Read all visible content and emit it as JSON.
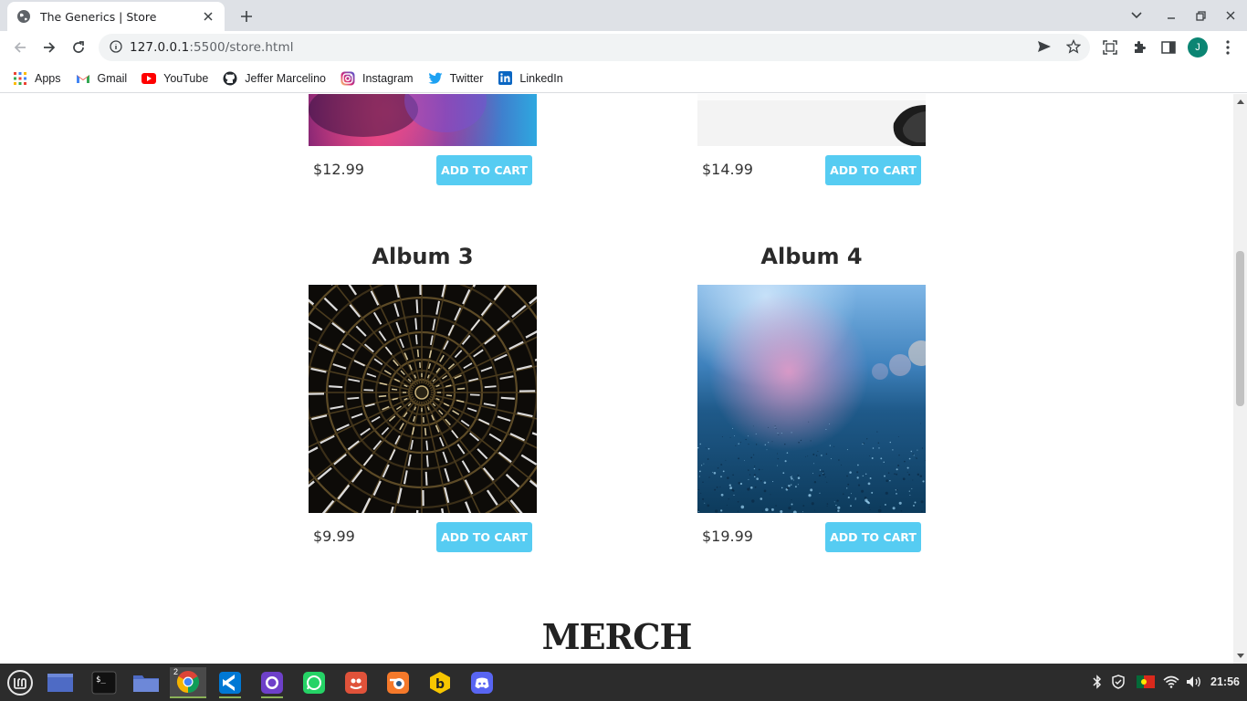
{
  "browser": {
    "tab_title": "The Generics | Store",
    "url_host": "127.0.0.1",
    "url_path": ":5500/store.html",
    "profile_initial": "J"
  },
  "bookmarks": [
    {
      "label": "Apps",
      "icon": "apps-grid-icon"
    },
    {
      "label": "Gmail",
      "icon": "gmail-icon"
    },
    {
      "label": "YouTube",
      "icon": "youtube-icon"
    },
    {
      "label": "Jeffer Marcelino",
      "icon": "github-icon"
    },
    {
      "label": "Instagram",
      "icon": "instagram-icon"
    },
    {
      "label": "Twitter",
      "icon": "twitter-icon"
    },
    {
      "label": "LinkedIn",
      "icon": "linkedin-icon"
    }
  ],
  "store": {
    "albums": [
      {
        "title": "",
        "price": "$12.99",
        "button": "ADD TO CART"
      },
      {
        "title": "",
        "price": "$14.99",
        "button": "ADD TO CART"
      },
      {
        "title": "Album 3",
        "price": "$9.99",
        "button": "ADD TO CART"
      },
      {
        "title": "Album 4",
        "price": "$19.99",
        "button": "ADD TO CART"
      }
    ],
    "merch_title": "MERCH"
  },
  "taskbar": {
    "clock": "21:56",
    "chrome_window_count": "2"
  },
  "colors": {
    "button": "#56ccf2",
    "taskbar": "#2c2c2c",
    "tabstrip": "#dee1e6"
  }
}
